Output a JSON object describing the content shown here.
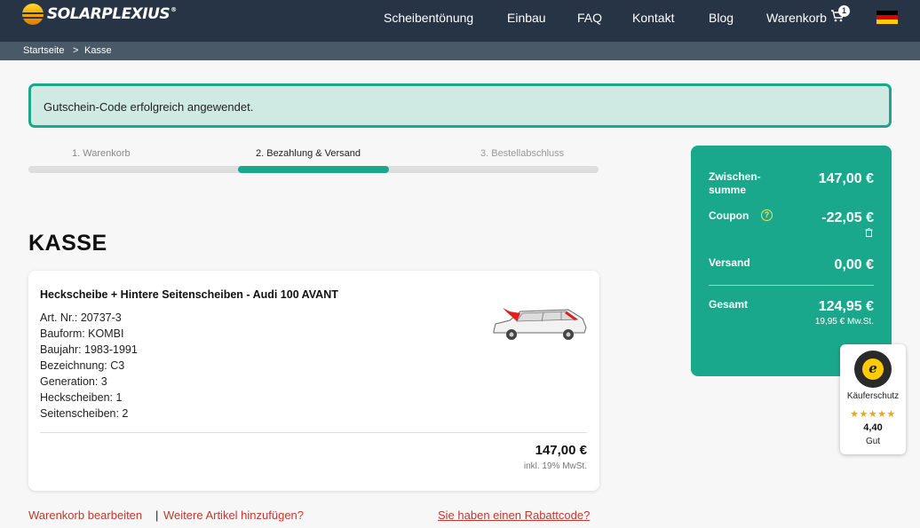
{
  "header": {
    "logo_text": "SOLARPLEXIUS",
    "logo_mark": "®",
    "nav": [
      "Scheibentönung",
      "Einbau",
      "FAQ",
      "Kontakt",
      "Blog",
      "Warenkorb"
    ],
    "cart_count": "1",
    "cart_icon": "cart-icon",
    "language_flag": "de-flag"
  },
  "breadcrumb": {
    "home": "Startseite",
    "separator": ">",
    "current": "Kasse"
  },
  "alert": {
    "message": "Gutschein-Code erfolgreich angewendet."
  },
  "steps": [
    {
      "label": "1. Warenkorb",
      "active": false
    },
    {
      "label": "2. Bezahlung & Versand",
      "active": true
    },
    {
      "label": "3. Bestellabschluss",
      "active": false
    }
  ],
  "page_title": "KASSE",
  "product": {
    "name": "Heckscheibe + Hintere Seitenscheiben - Audi 100 AVANT",
    "attributes": [
      "Art. Nr.: 20737-3",
      "Bauform: KOMBI",
      "Baujahr: 1983-1991",
      "Bezeichnung: C3",
      "Generation: 3",
      "Heckscheiben: 1",
      "Seitenscheiben: 2"
    ],
    "price": "147,00 €",
    "tax_note": "inkl. 19% MwSt."
  },
  "footer_links": {
    "edit_cart": "Warenkorb bearbeiten",
    "separator": "|",
    "add_more": "Weitere Artikel hinzufügen?",
    "coupon": "Sie haben einen Rabattcode?"
  },
  "summary": {
    "subtotal_label": "Zwischen-\nsumme",
    "subtotal_value": "147,00 €",
    "coupon_label": "Coupon",
    "coupon_value": "-22,05 €",
    "shipping_label": "Versand",
    "shipping_value": "0,00 €",
    "total_label": "Gesamt",
    "total_value": "124,95 €",
    "total_tax": "19,95 € Mw.St."
  },
  "trust_badge": {
    "label": "Käuferschutz",
    "stars": "★★★★★",
    "score": "4,40",
    "grade": "Gut"
  },
  "colors": {
    "header_bg": "#263445",
    "breadcrumb_bg": "#495968",
    "accent": "#1aa88c",
    "alert_bg": "#cfeae2",
    "link": "#c0392b"
  }
}
